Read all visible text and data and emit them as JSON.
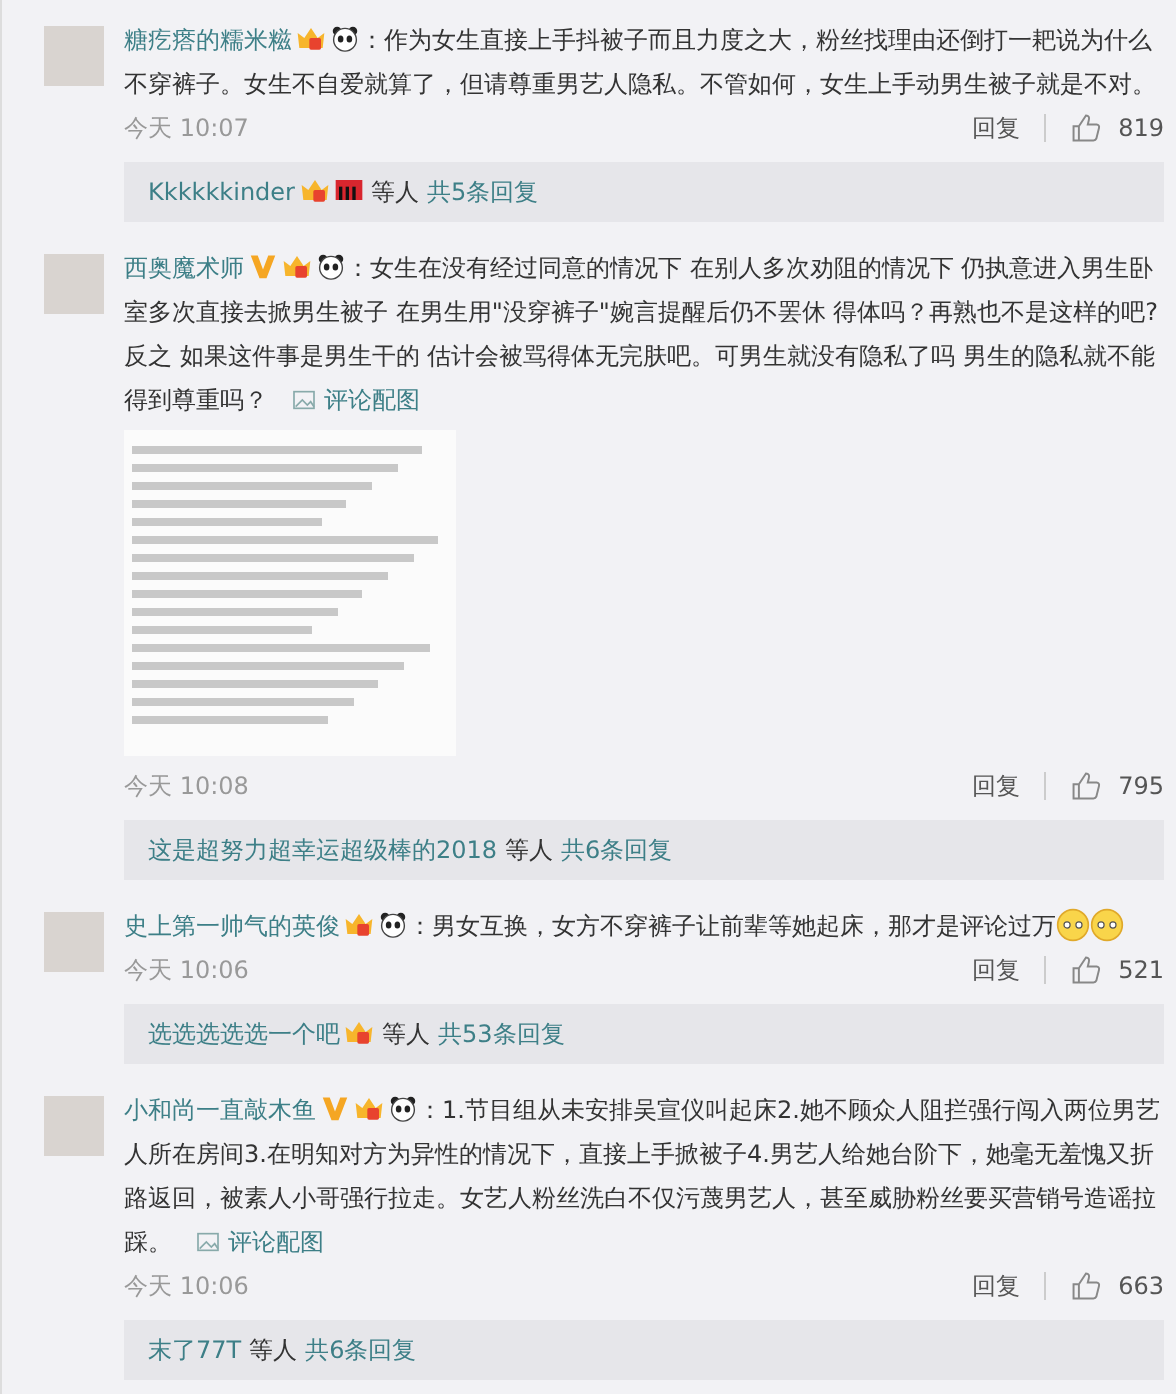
{
  "comments": [
    {
      "name": "糖疙瘩的糯米糍",
      "badges": [
        {
          "kind": "crown"
        },
        {
          "kind": "panda"
        }
      ],
      "text": "：作为女生直接上手抖被子而且力度之大，粉丝找理由还倒打一耙说为什么不穿裤子。女生不自爱就算了，但请尊重男艺人隐私。不管如何，女生上手动男生被子就是不对。",
      "time": "今天 10:07",
      "reply_label": "回复",
      "likes": "819",
      "replies": {
        "name": "Kkkkkkinder",
        "badges": [
          {
            "kind": "crown"
          },
          {
            "kind": "piano"
          }
        ],
        "others": "等人",
        "count": "共5条回复"
      }
    },
    {
      "name": "西奥魔术师",
      "badges": [
        {
          "kind": "verified"
        },
        {
          "kind": "crown"
        },
        {
          "kind": "panda"
        }
      ],
      "text": "：女生在没有经过同意的情况下 在别人多次劝阻的情况下 仍执意进入男生卧室多次直接去掀男生被子 在男生用\"没穿裤子\"婉言提醒后仍不罢休 得体吗？再熟也不是这样的吧? 反之 如果这件事是男生干的 估计会被骂得体无完肤吧。可男生就没有隐私了吗 男生的隐私就不能得到尊重吗？",
      "attachment_link": "评论配图",
      "image": true,
      "time": "今天 10:08",
      "reply_label": "回复",
      "likes": "795",
      "replies": {
        "name": "这是超努力超幸运超级棒的2018",
        "others": "等人",
        "count": "共6条回复"
      }
    },
    {
      "name": "史上第一帅气的英俊",
      "badges": [
        {
          "kind": "crown"
        },
        {
          "kind": "panda"
        }
      ],
      "text": "：男女互换，女方不穿裤子让前辈等她起床，那才是评论过万",
      "emojis": [
        {
          "kind": "awkward"
        },
        {
          "kind": "awkward"
        }
      ],
      "time": "今天 10:06",
      "reply_label": "回复",
      "likes": "521",
      "replies": {
        "name": "选选选选选一个吧",
        "badges": [
          {
            "kind": "crown"
          }
        ],
        "others": "等人",
        "count": "共53条回复"
      }
    },
    {
      "name": "小和尚一直敲木鱼",
      "badges": [
        {
          "kind": "verified"
        },
        {
          "kind": "crown"
        },
        {
          "kind": "panda"
        }
      ],
      "text": "：1.节目组从未安排吴宣仪叫起床2.她不顾众人阻拦强行闯入两位男艺人所在房间3.在明知对方为异性的情况下，直接上手掀被子4.男艺人给她台阶下，她毫无羞愧又折路返回，被素人小哥强行拉走。女艺人粉丝洗白不仅污蔑男艺人，甚至威胁粉丝要买营销号造谣拉踩。",
      "attachment_link": "评论配图",
      "time": "今天 10:06",
      "reply_label": "回复",
      "likes": "663",
      "replies": {
        "name": "末了77T",
        "others": "等人",
        "count": "共6条回复"
      }
    }
  ]
}
